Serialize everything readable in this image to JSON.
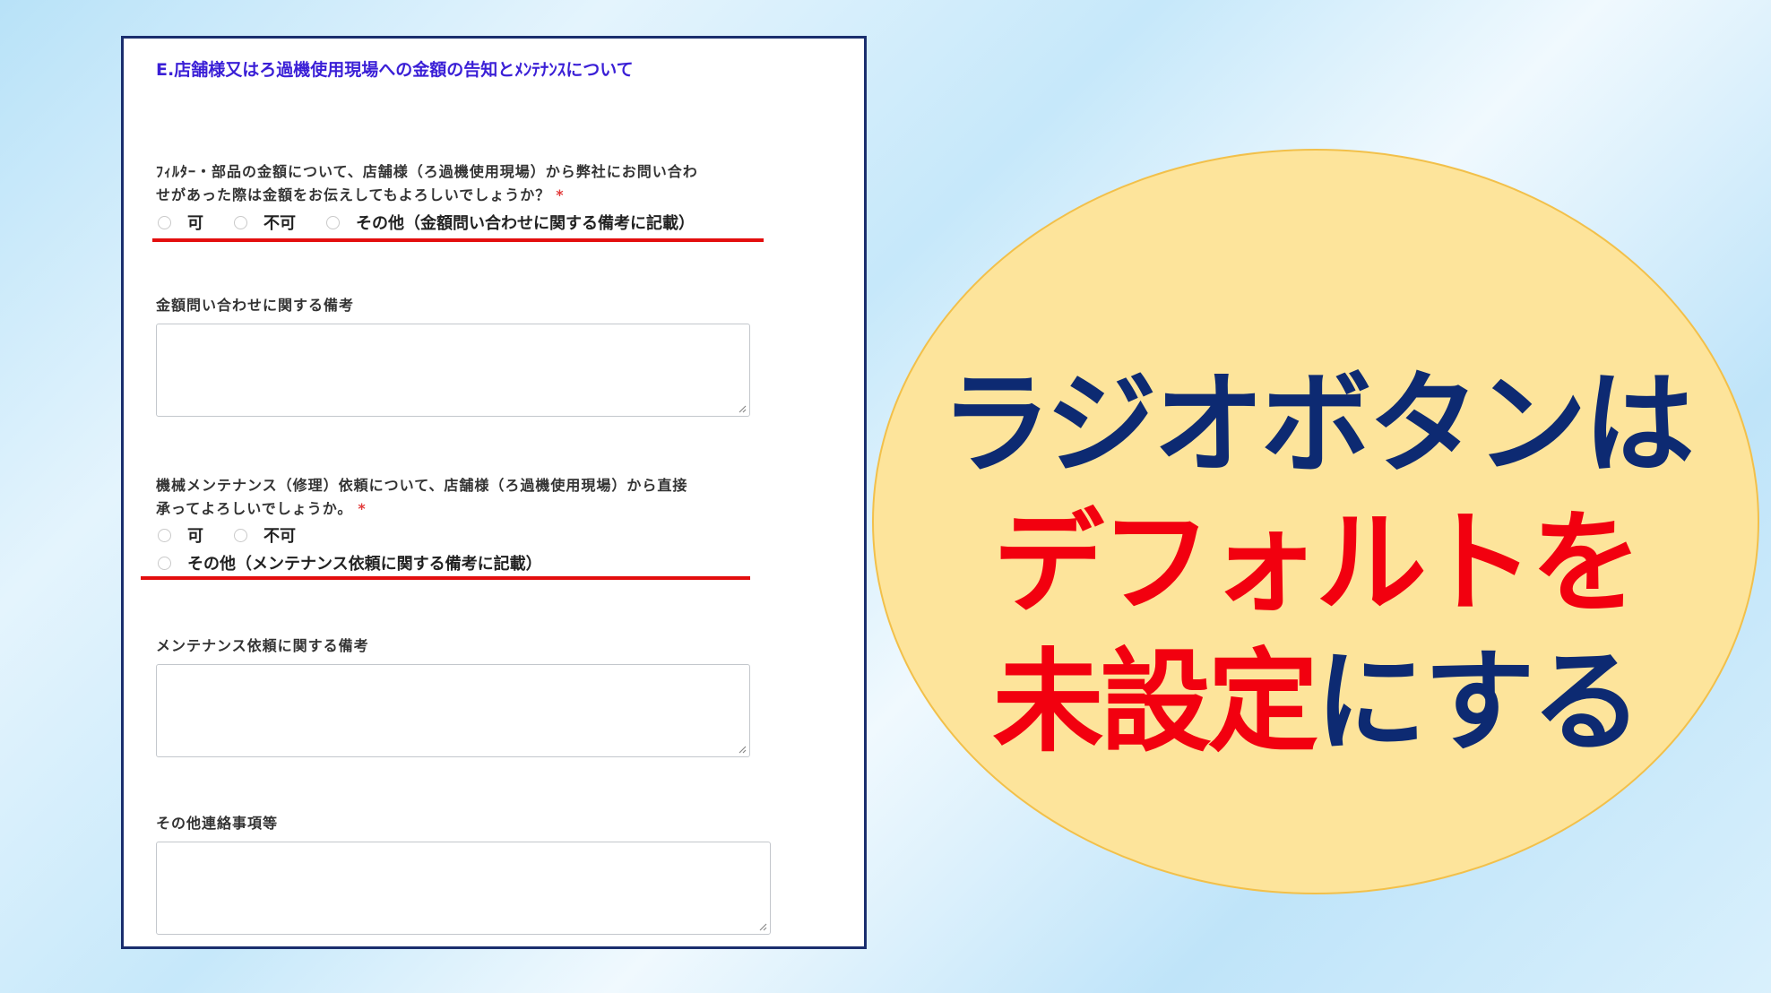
{
  "form": {
    "section_title": "E.店舗様又はろ過機使用現場への金額の告知とﾒﾝﾃﾅﾝｽについて",
    "q1": {
      "label_line1": "ﾌｨﾙﾀｰ・部品の金額について、店舗様（ろ過機使用現場）から弊社にお問い合わ",
      "label_line2": "せがあった際は金額をお伝えしてもよろしいでしょうか？",
      "required_mark": "*",
      "options": [
        "可",
        "不可",
        "その他（金額問い合わせに関する備考に記載）"
      ]
    },
    "notes1_label": "金額問い合わせに関する備考",
    "q2": {
      "label_line1": "機械メンテナンス（修理）依頼について、店舗様（ろ過機使用現場）から直接",
      "label_line2": "承ってよろしいでしょうか。",
      "required_mark": "*",
      "options": [
        "可",
        "不可",
        "その他（メンテナンス依頼に関する備考に記載）"
      ]
    },
    "notes2_label": "メンテナンス依頼に関する備考",
    "notes3_label": "その他連絡事項等"
  },
  "callout": {
    "line1": "ラジオボタンは",
    "line2": "デフォルトを",
    "line3_red": "未設定",
    "line3_navy": "にする"
  },
  "colors": {
    "callout_fill": "#fde49b",
    "navy_text": "#0d2a72",
    "red_text": "#f2000f",
    "underline": "#e30e0e",
    "section_title": "#3a1fd6"
  }
}
